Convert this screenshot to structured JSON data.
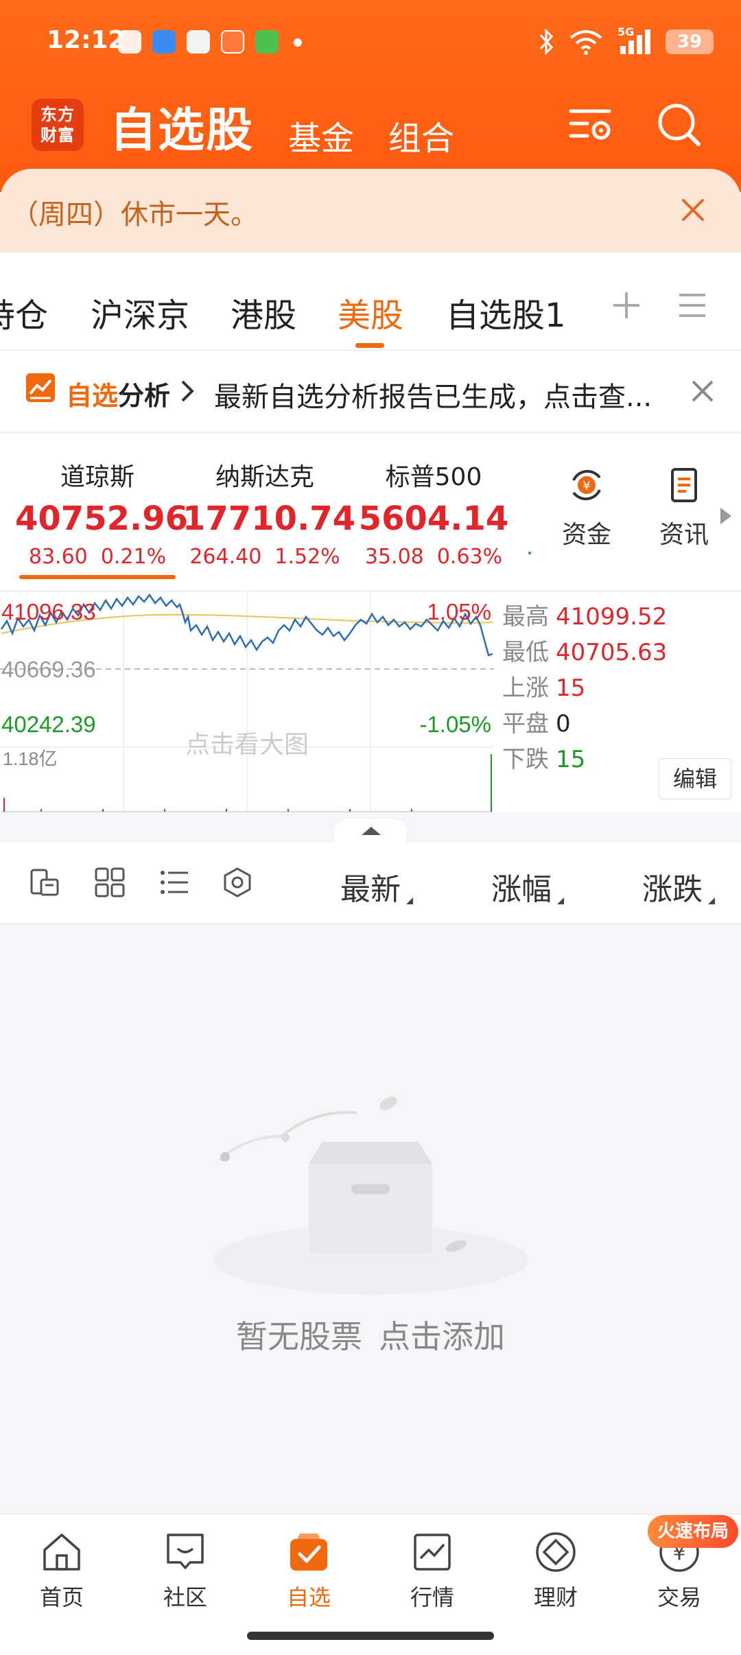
{
  "status_bar": {
    "time": "12:12",
    "network": "5G",
    "battery": "39"
  },
  "header": {
    "logo_text": "东方\n财富",
    "title": "自选股",
    "tabs": [
      "基金",
      "组合"
    ]
  },
  "notice": {
    "text": "（周四）休市一天。"
  },
  "tabs": [
    {
      "label": "持仓"
    },
    {
      "label": "沪深京"
    },
    {
      "label": "港股"
    },
    {
      "label": "美股"
    },
    {
      "label": "自选股1"
    }
  ],
  "active_tab": "美股",
  "analysis": {
    "title_highlight": "自选",
    "title_rest": "分析",
    "text": "最新自选分析报告已生成，点击查..."
  },
  "indexes": [
    {
      "name": "道琼斯",
      "value": "40752.96",
      "change": "83.60",
      "pct": "0.21%"
    },
    {
      "name": "纳斯达克",
      "value": "17710.74",
      "change": "264.40",
      "pct": "1.52%"
    },
    {
      "name": "标普500",
      "value": "5604.14",
      "change": "35.08",
      "pct": "0.63%"
    }
  ],
  "side_buttons": [
    {
      "label": "资金",
      "icon": "fund-flow-icon"
    },
    {
      "label": "资讯",
      "icon": "news-icon"
    }
  ],
  "chart": {
    "top_price": "41096.33",
    "mid_price": "40669.36",
    "bottom_price": "40242.39",
    "top_pct": "1.05%",
    "bottom_pct": "-1.05%",
    "volume": "1.18亿",
    "hint": "点击看大图"
  },
  "stats": {
    "high_label": "最高",
    "high": "41099.52",
    "low_label": "最低",
    "low": "40705.63",
    "up_label": "上涨",
    "up": "15",
    "flat_label": "平盘",
    "flat": "0",
    "down_label": "下跌",
    "down": "15",
    "edit": "编辑"
  },
  "toolbar": {
    "sort_latest": "最新",
    "sort_pct": "涨幅",
    "sort_change": "涨跌"
  },
  "empty": {
    "text1": "暂无股票",
    "text2": "点击添加"
  },
  "bottom_nav": [
    {
      "label": "首页",
      "icon": "home-icon"
    },
    {
      "label": "社区",
      "icon": "community-icon"
    },
    {
      "label": "自选",
      "icon": "watchlist-icon"
    },
    {
      "label": "行情",
      "icon": "market-icon"
    },
    {
      "label": "理财",
      "icon": "wealth-icon"
    },
    {
      "label": "交易",
      "icon": "trade-icon"
    }
  ],
  "active_nav": "自选",
  "promo": "火速布局",
  "colors": {
    "brand": "#ff5a10",
    "up": "#e0262b",
    "down": "#1a9a28",
    "accent": "#f0690f"
  }
}
